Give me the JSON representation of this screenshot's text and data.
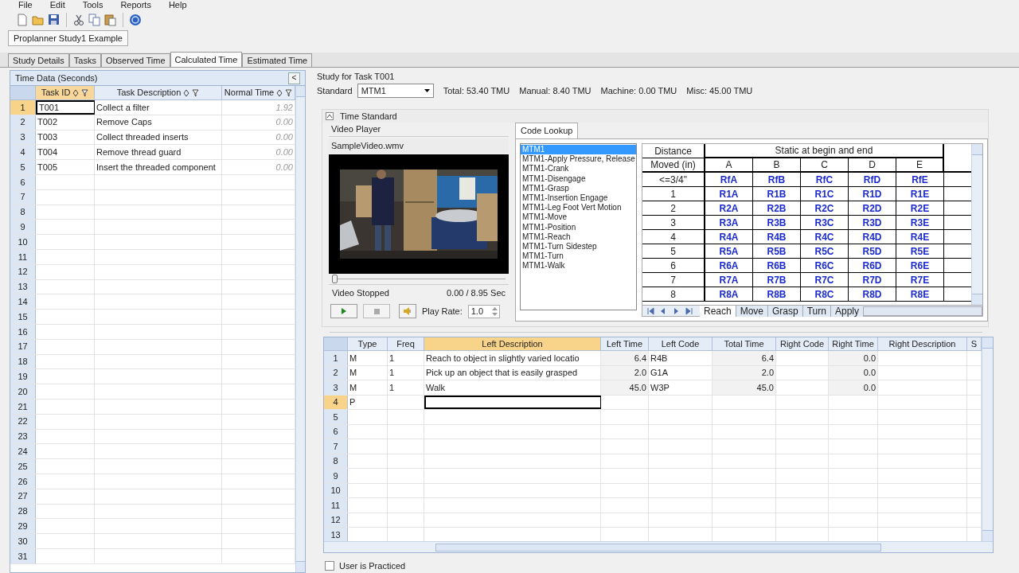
{
  "menu": [
    "File",
    "Edit",
    "Tools",
    "Reports",
    "Help"
  ],
  "document_tab": {
    "label": "Proplanner Study1 Example",
    "selected": true
  },
  "tabs": [
    {
      "label": "Study Details",
      "selected": false
    },
    {
      "label": "Tasks",
      "selected": false
    },
    {
      "label": "Observed Time",
      "selected": false
    },
    {
      "label": "Calculated Time",
      "selected": true
    },
    {
      "label": "Estimated Time",
      "selected": false
    }
  ],
  "time_data": {
    "title": "Time Data (Seconds)",
    "collapse_button": "<",
    "columns": [
      "Task ID",
      "Task Description",
      "Normal Time"
    ],
    "rows": [
      {
        "number": "1",
        "task_id": "T001",
        "description": "Collect a filter",
        "normal_time": "1.92",
        "selected": true
      },
      {
        "number": "2",
        "task_id": "T002",
        "description": "Remove Caps",
        "normal_time": "0.00",
        "selected": false
      },
      {
        "number": "3",
        "task_id": "T003",
        "description": "Collect threaded inserts",
        "normal_time": "0.00",
        "selected": false
      },
      {
        "number": "4",
        "task_id": "T004",
        "description": "Remove thread guard",
        "normal_time": "0.00",
        "selected": false
      },
      {
        "number": "5",
        "task_id": "T005",
        "description": "Insert the threaded component",
        "normal_time": "0.00",
        "selected": false
      },
      {
        "number": "6",
        "selected": false
      },
      {
        "number": "7",
        "selected": false
      },
      {
        "number": "8",
        "selected": false
      },
      {
        "number": "9",
        "selected": false
      },
      {
        "number": "10",
        "selected": false
      },
      {
        "number": "11",
        "selected": false
      },
      {
        "number": "12",
        "selected": false
      },
      {
        "number": "13",
        "selected": false
      },
      {
        "number": "14",
        "selected": false
      },
      {
        "number": "15",
        "selected": false
      },
      {
        "number": "16",
        "selected": false
      },
      {
        "number": "17",
        "selected": false
      },
      {
        "number": "18",
        "selected": false
      },
      {
        "number": "19",
        "selected": false
      },
      {
        "number": "20",
        "selected": false
      },
      {
        "number": "21",
        "selected": false
      },
      {
        "number": "22",
        "selected": false
      },
      {
        "number": "23",
        "selected": false
      },
      {
        "number": "24",
        "selected": false
      },
      {
        "number": "25",
        "selected": false
      },
      {
        "number": "26",
        "selected": false
      },
      {
        "number": "27",
        "selected": false
      },
      {
        "number": "28",
        "selected": false
      },
      {
        "number": "29",
        "selected": false
      },
      {
        "number": "30",
        "selected": false
      },
      {
        "number": "31",
        "selected": false
      }
    ]
  },
  "study": {
    "title": "Study for Task T001",
    "standard_label": "Standard",
    "standard_value": "MTM1",
    "totals": [
      "Total: 53.40 TMU",
      "Manual: 8.40 TMU",
      "Machine: 0.00 TMU",
      "Misc: 45.00 TMU"
    ]
  },
  "time_standard": {
    "title": "Time Standard",
    "expanded": true
  },
  "video_player": {
    "title": "Video Player",
    "file": "SampleVideo.wmv",
    "level": 0,
    "status": "Video Stopped",
    "time": "0.00 / 8.95 Sec",
    "play_rate_label": "Play Rate:",
    "play_rate": "1.0"
  },
  "code_lookup": {
    "tab": "Code Lookup",
    "standards": [
      {
        "label": "MTM1",
        "selected": true
      },
      {
        "label": "MTM1-Apply Pressure, Release",
        "selected": false
      },
      {
        "label": "MTM1-Crank",
        "selected": false
      },
      {
        "label": "MTM1-Disengage",
        "selected": false
      },
      {
        "label": "MTM1-Grasp",
        "selected": false
      },
      {
        "label": "MTM1-Insertion Engage",
        "selected": false
      },
      {
        "label": "MTM1-Leg Foot Vert Motion",
        "selected": false
      },
      {
        "label": "MTM1-Move",
        "selected": false
      },
      {
        "label": "MTM1-Position",
        "selected": false
      },
      {
        "label": "MTM1-Reach",
        "selected": false
      },
      {
        "label": "MTM1-Turn Sidestep",
        "selected": false
      },
      {
        "label": "MTM1-Turn",
        "selected": false
      },
      {
        "label": "MTM1-Walk",
        "selected": false
      }
    ],
    "table": {
      "corner_top": "Distance",
      "corner_bottom": "Moved (in)",
      "group": "Static at begin and end",
      "columns": [
        "A",
        "B",
        "C",
        "D",
        "E"
      ],
      "rows": [
        {
          "distance": "<=3/4\"",
          "codes": [
            "RfA",
            "RfB",
            "RfC",
            "RfD",
            "RfE"
          ]
        },
        {
          "distance": "1",
          "codes": [
            "R1A",
            "R1B",
            "R1C",
            "R1D",
            "R1E"
          ]
        },
        {
          "distance": "2",
          "codes": [
            "R2A",
            "R2B",
            "R2C",
            "R2D",
            "R2E"
          ]
        },
        {
          "distance": "3",
          "codes": [
            "R3A",
            "R3B",
            "R3C",
            "R3D",
            "R3E"
          ]
        },
        {
          "distance": "4",
          "codes": [
            "R4A",
            "R4B",
            "R4C",
            "R4D",
            "R4E"
          ]
        },
        {
          "distance": "5",
          "codes": [
            "R5A",
            "R5B",
            "R5C",
            "R5D",
            "R5E"
          ]
        },
        {
          "distance": "6",
          "codes": [
            "R6A",
            "R6B",
            "R6C",
            "R6D",
            "R6E"
          ]
        },
        {
          "distance": "7",
          "codes": [
            "R7A",
            "R7B",
            "R7C",
            "R7D",
            "R7E"
          ]
        },
        {
          "distance": "8",
          "codes": [
            "R8A",
            "R8B",
            "R8C",
            "R8D",
            "R8E"
          ]
        }
      ]
    },
    "sheets": [
      {
        "label": "Reach",
        "selected": true
      },
      {
        "label": "Move",
        "selected": false
      },
      {
        "label": "Grasp",
        "selected": false
      },
      {
        "label": "Turn",
        "selected": false
      },
      {
        "label": "Apply",
        "selected": false
      }
    ]
  },
  "elements": {
    "columns": [
      {
        "label": "Type",
        "selected": false
      },
      {
        "label": "Freq",
        "selected": false
      },
      {
        "label": "Left Description",
        "selected": true
      },
      {
        "label": "Left Time",
        "selected": false
      },
      {
        "label": "Left Code",
        "selected": false
      },
      {
        "label": "Total Time",
        "selected": false
      },
      {
        "label": "Right Code",
        "selected": false
      },
      {
        "label": "Right Time",
        "selected": false
      },
      {
        "label": "Right Description",
        "selected": false
      },
      {
        "label": "S",
        "selected": false
      }
    ],
    "rows": [
      {
        "number": "1",
        "cells": [
          "M",
          "1",
          "Reach to object in slightly varied locatio",
          "6.4",
          "R4B",
          "6.4",
          "",
          "0.0",
          "",
          ""
        ],
        "selected": false
      },
      {
        "number": "2",
        "cells": [
          "M",
          "1",
          "Pick up an object that is easily grasped",
          "2.0",
          "G1A",
          "2.0",
          "",
          "0.0",
          "",
          ""
        ],
        "selected": false
      },
      {
        "number": "3",
        "cells": [
          "M",
          "1",
          "Walk",
          "45.0",
          "W3P",
          "45.0",
          "",
          "0.0",
          "",
          ""
        ],
        "selected": false
      },
      {
        "number": "4",
        "cells": [
          "P",
          "",
          "",
          "",
          "",
          "",
          "",
          "",
          "",
          ""
        ],
        "selected": true
      },
      {
        "number": "5",
        "selected": false
      },
      {
        "number": "6",
        "selected": false
      },
      {
        "number": "7",
        "selected": false
      },
      {
        "number": "8",
        "selected": false
      },
      {
        "number": "9",
        "selected": false
      },
      {
        "number": "10",
        "selected": false
      },
      {
        "number": "11",
        "selected": false
      },
      {
        "number": "12",
        "selected": false
      },
      {
        "number": "13",
        "selected": false
      }
    ]
  },
  "user_is_practiced": {
    "label": "User is Practiced",
    "checked": false
  }
}
